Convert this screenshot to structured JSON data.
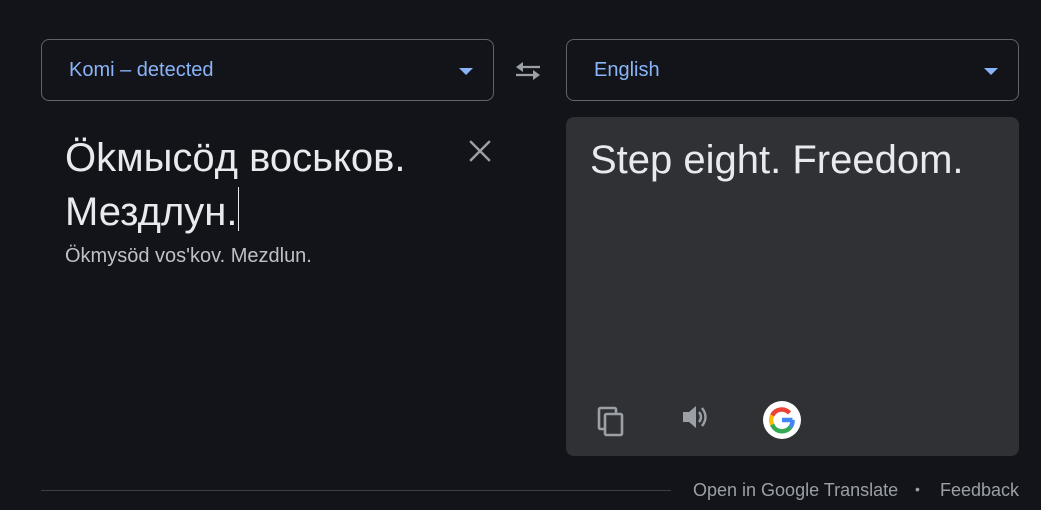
{
  "source_language": {
    "label": "Komi – detected"
  },
  "target_language": {
    "label": "English"
  },
  "source": {
    "text": "Ökмысӧд воськов. Мездлун.",
    "transliteration": "Ökmysöd vos'kov. Mezdlun."
  },
  "target": {
    "text": "Step eight. Freedom."
  },
  "footer": {
    "open_label": "Open in Google Translate",
    "separator": "•",
    "feedback_label": "Feedback"
  },
  "colors": {
    "background": "#131419",
    "accent": "#8ab4f8",
    "panel": "#303134",
    "text": "#e8eaed",
    "muted": "#9aa0a6"
  },
  "icons": [
    "swap-arrows-icon",
    "close-icon",
    "copy-icon",
    "speaker-icon",
    "google-g-logo"
  ]
}
